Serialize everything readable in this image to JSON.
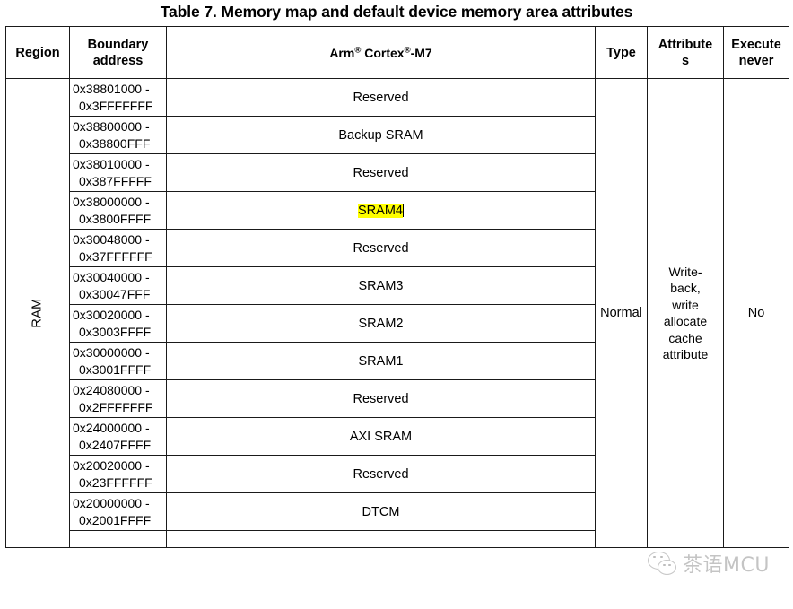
{
  "document": {
    "table_title": "Table 7. Memory map and default device memory area attributes"
  },
  "table": {
    "headers": {
      "region": "Region",
      "boundary_address_l1": "Boundary",
      "boundary_address_l2": "address",
      "description_pre": "Arm",
      "description_sup1": "®",
      "description_mid": " Cortex",
      "description_sup2": "®",
      "description_post": "-M7",
      "type": "Type",
      "attributes_l1": "Attribute",
      "attributes_l2": "s",
      "execute_never_l1": "Execute",
      "execute_never_l2": "never"
    },
    "region_label": "RAM",
    "type_value": "Normal",
    "attributes_value": "Write-back, write allocate cache attribute",
    "attributes_lines": [
      "Write-",
      "back,",
      "write",
      "allocate",
      "cache",
      "attribute"
    ],
    "execute_never_value": "No",
    "highlight_color": "#ffff00",
    "rows": [
      {
        "addr_start": "0x38801000 -",
        "addr_end": "0x3FFFFFFF",
        "description": "Reserved",
        "highlighted": false
      },
      {
        "addr_start": "0x38800000 -",
        "addr_end": "0x38800FFF",
        "description": "Backup SRAM",
        "highlighted": false
      },
      {
        "addr_start": "0x38010000 -",
        "addr_end": "0x387FFFFF",
        "description": "Reserved",
        "highlighted": false
      },
      {
        "addr_start": "0x38000000 -",
        "addr_end": "0x3800FFFF",
        "description": "SRAM4",
        "highlighted": true
      },
      {
        "addr_start": "0x30048000 -",
        "addr_end": "0x37FFFFFF",
        "description": "Reserved",
        "highlighted": false
      },
      {
        "addr_start": "0x30040000 -",
        "addr_end": "0x30047FFF",
        "description": "SRAM3",
        "highlighted": false
      },
      {
        "addr_start": "0x30020000 -",
        "addr_end": "0x3003FFFF",
        "description": "SRAM2",
        "highlighted": false
      },
      {
        "addr_start": "0x30000000 -",
        "addr_end": "0x3001FFFF",
        "description": "SRAM1",
        "highlighted": false
      },
      {
        "addr_start": "0x24080000 -",
        "addr_end": "0x2FFFFFFF",
        "description": "Reserved",
        "highlighted": false
      },
      {
        "addr_start": "0x24000000 -",
        "addr_end": "0x2407FFFF",
        "description": "AXI SRAM",
        "highlighted": false
      },
      {
        "addr_start": "0x20020000 -",
        "addr_end": "0x23FFFFFF",
        "description": "Reserved",
        "highlighted": false
      },
      {
        "addr_start": "0x20000000 -",
        "addr_end": "0x2001FFFF",
        "description": "DTCM",
        "highlighted": false
      }
    ]
  },
  "watermark": {
    "text": "茶语MCU",
    "icon": "wechat-icon",
    "color": "#bfbfbf"
  }
}
